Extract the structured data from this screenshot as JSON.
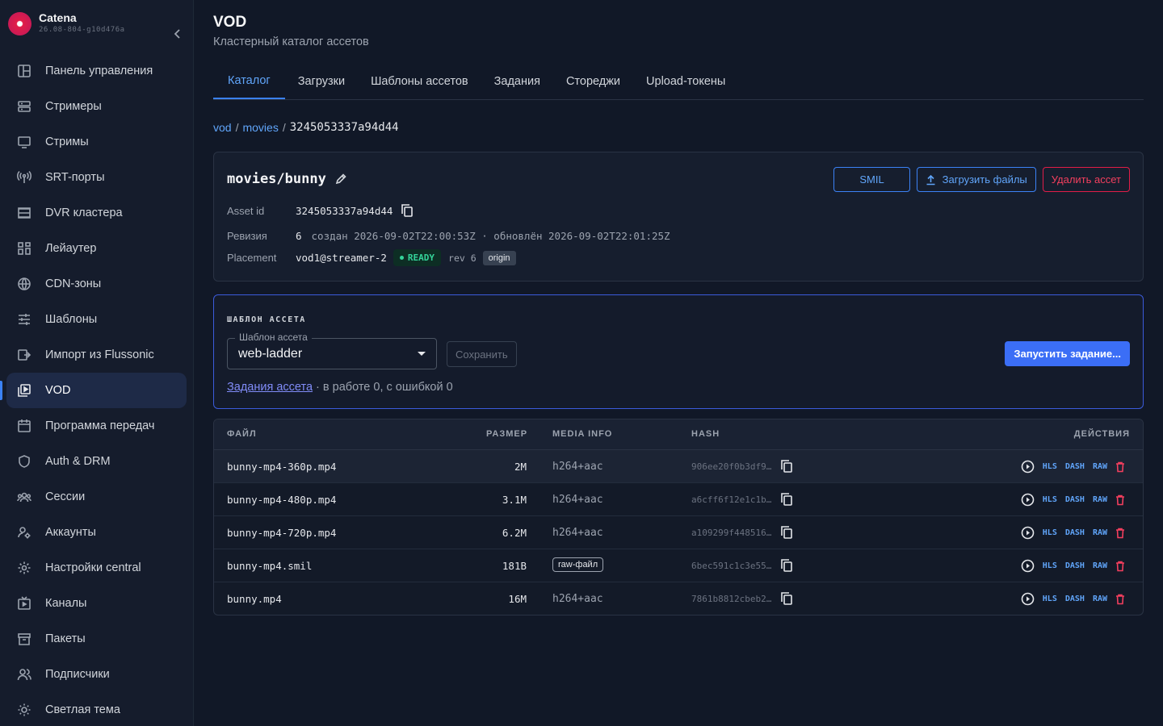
{
  "brand": {
    "name": "Catena",
    "version": "26.08-804-g10d476a"
  },
  "sidebar": {
    "items": [
      {
        "label": "Панель управления",
        "icon": "dashboard-icon"
      },
      {
        "label": "Стримеры",
        "icon": "server-icon"
      },
      {
        "label": "Стримы",
        "icon": "monitor-icon"
      },
      {
        "label": "SRT-порты",
        "icon": "antenna-icon"
      },
      {
        "label": "DVR кластера",
        "icon": "storage-icon"
      },
      {
        "label": "Лейаутер",
        "icon": "layout-icon"
      },
      {
        "label": "CDN-зоны",
        "icon": "globe-icon"
      },
      {
        "label": "Шаблоны",
        "icon": "sliders-icon"
      },
      {
        "label": "Импорт из Flussonic",
        "icon": "import-icon"
      },
      {
        "label": "VOD",
        "icon": "video-library-icon",
        "active": true
      },
      {
        "label": "Программа передач",
        "icon": "calendar-icon"
      },
      {
        "label": "Auth & DRM",
        "icon": "shield-icon"
      },
      {
        "label": "Сессии",
        "icon": "users-icon"
      },
      {
        "label": "Аккаунты",
        "icon": "account-icon"
      },
      {
        "label": "Настройки central",
        "icon": "gear-icon"
      },
      {
        "label": "Каналы",
        "icon": "tv-icon"
      },
      {
        "label": "Пакеты",
        "icon": "archive-icon"
      },
      {
        "label": "Подписчики",
        "icon": "subscribers-icon"
      },
      {
        "label": "Светлая тема",
        "icon": "sun-icon"
      }
    ]
  },
  "page": {
    "title": "VOD",
    "subtitle": "Кластерный каталог ассетов"
  },
  "tabs": [
    "Каталог",
    "Загрузки",
    "Шаблоны ассетов",
    "Задания",
    "Стореджи",
    "Upload-токены"
  ],
  "breadcrumb": {
    "root": "vod",
    "folder": "movies",
    "sep": "/",
    "current": "3245053337a94d44"
  },
  "asset": {
    "title": "movies/bunny",
    "buttons": {
      "smil": "SMIL",
      "upload": "Загрузить файлы",
      "delete": "Удалить ассет"
    },
    "id_label": "Asset id",
    "id": "3245053337a94d44",
    "revision_label": "Ревизия",
    "revision": "6",
    "revision_info": "создан 2026-09-02T22:00:53Z · обновлён 2026-09-02T22:01:25Z",
    "placement_label": "Placement",
    "placement": "vod1@streamer-2",
    "status": "READY",
    "rev": "rev 6",
    "role": "origin"
  },
  "template": {
    "heading": "ШАБЛОН АССЕТА",
    "select_label": "Шаблон ассета",
    "select_value": "web-ladder",
    "save": "Сохранить",
    "run": "Запустить задание...",
    "jobs_link": "Задания ассета",
    "jobs_status": " · в работе 0, с ошибкой 0"
  },
  "files": {
    "headers": {
      "file": "ФАЙЛ",
      "size": "РАЗМЕР",
      "media": "MEDIA INFO",
      "hash": "HASH",
      "actions": "ДЕЙСТВИЯ"
    },
    "action_labels": {
      "hls": "HLS",
      "dash": "DASH",
      "raw": "RAW"
    },
    "rows": [
      {
        "name": "bunny-mp4-360p.mp4",
        "size": "2M",
        "media": "h264+aac",
        "hash": "906ee20f0b3df9…"
      },
      {
        "name": "bunny-mp4-480p.mp4",
        "size": "3.1M",
        "media": "h264+aac",
        "hash": "a6cff6f12e1c1b…"
      },
      {
        "name": "bunny-mp4-720p.mp4",
        "size": "6.2M",
        "media": "h264+aac",
        "hash": "a109299f448516…"
      },
      {
        "name": "bunny-mp4.smil",
        "size": "181B",
        "media": "raw-файл",
        "hash": "6bec591c1c3e55…"
      },
      {
        "name": "bunny.mp4",
        "size": "16M",
        "media": "h264+aac",
        "hash": "7861b8812cbeb2…"
      }
    ]
  }
}
